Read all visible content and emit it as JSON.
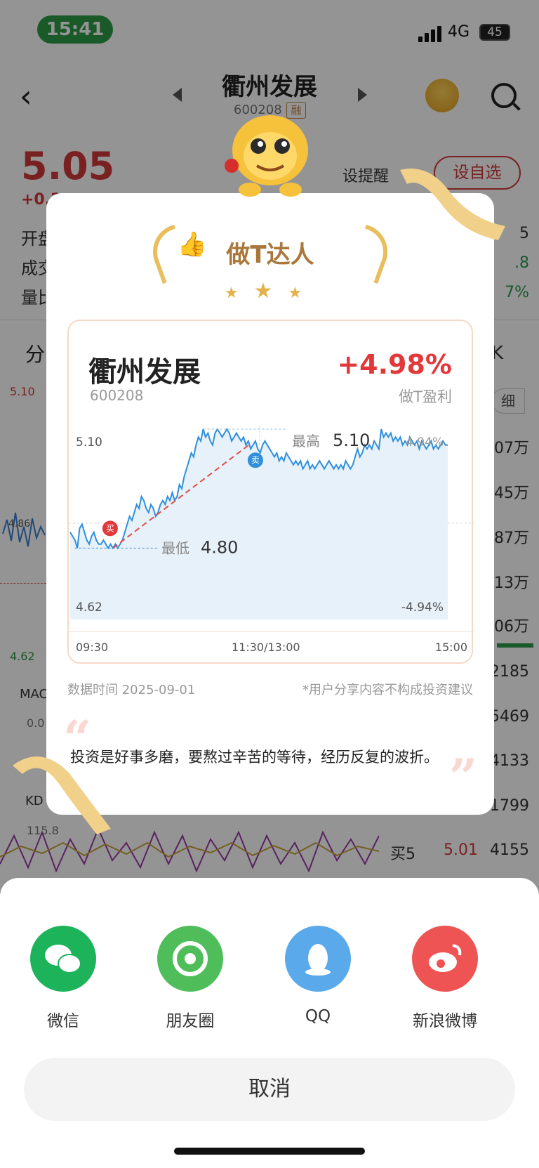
{
  "status_bar": {
    "time": "15:41",
    "network": "4G",
    "battery": "45"
  },
  "header": {
    "title": "衢州发展",
    "code": "600208",
    "margin_tag": "融"
  },
  "quote": {
    "price": "5.05",
    "change": "+0.2",
    "left_labels": [
      "开盘",
      "成交",
      "量比"
    ],
    "remind_label": "设提醒",
    "favorite_label": "设自选",
    "right_values": [
      "5",
      ".8",
      "7%"
    ]
  },
  "bg_tabs": {
    "tab_fen": "分",
    "tab_k": "K",
    "detail": "细"
  },
  "bg_chart": {
    "high": "5.10",
    "low": "4.62",
    "mid": "4.86",
    "macd": "MAC",
    "macd_val": "0.0",
    "kdj": "KD",
    "kdj_val": "115.8"
  },
  "bg_volumes": [
    "4.07万",
    "1.45万",
    "1.87万",
    "1.13万",
    "1.06万",
    "2185",
    "5469",
    "4133",
    "1799"
  ],
  "bg_buy5": {
    "label": "买5",
    "price": "5.01",
    "volume": "4155"
  },
  "card": {
    "badge_title": "做T达人",
    "stock_name": "衢州发展",
    "stock_code": "600208",
    "profit_pct": "+4.98%",
    "profit_label": "做T盈利",
    "data_date": "数据时间 2025-09-01",
    "disclaimer": "*用户分享内容不构成投资建议",
    "quote_text": "投资是好事多磨，要熬过辛苦的等待，经历反复的波折。"
  },
  "chart_data": {
    "type": "line",
    "title": "",
    "y_axis_left": {
      "top": "5.10",
      "bottom": "4.62"
    },
    "y_axis_right": {
      "top": "4.94%",
      "bottom": "-4.94%"
    },
    "ylim": [
      4.62,
      5.1
    ],
    "x_ticks": [
      "09:30",
      "11:30/13:00",
      "15:00"
    ],
    "high_label": "最高",
    "high_value": "5.10",
    "low_label": "最低",
    "low_value": "4.80",
    "buy_marker": {
      "label": "买",
      "time_index": 18,
      "price": 4.8
    },
    "sell_marker": {
      "label": "卖",
      "time_index": 78,
      "price": 5.05
    },
    "grid": true,
    "series": [
      {
        "values": [
          4.84,
          4.83,
          4.82,
          4.8,
          4.85,
          4.86,
          4.84,
          4.82,
          4.81,
          4.83,
          4.84,
          4.82,
          4.81,
          4.81,
          4.82,
          4.81,
          4.8,
          4.81,
          4.8,
          4.81,
          4.8,
          4.81,
          4.82,
          4.84,
          4.86,
          4.88,
          4.87,
          4.89,
          4.91,
          4.9,
          4.93,
          4.92,
          4.9,
          4.89,
          4.91,
          4.9,
          4.88,
          4.89,
          4.91,
          4.92,
          4.91,
          4.93,
          4.92,
          4.94,
          4.92,
          4.93,
          4.96,
          4.95,
          4.98,
          5.0,
          5.02,
          5.04,
          5.03,
          5.06,
          5.08,
          5.07,
          5.1,
          5.08,
          5.09,
          5.07,
          5.06,
          5.09,
          5.1,
          5.09,
          5.08,
          5.09,
          5.1,
          5.09,
          5.07,
          5.08,
          5.09,
          5.08,
          5.07,
          5.08,
          5.06,
          5.07,
          5.05,
          5.06,
          5.07,
          5.05,
          5.04,
          5.06,
          5.07,
          5.06,
          5.05,
          5.04,
          5.03,
          5.04,
          5.02,
          5.03,
          5.02,
          5.04,
          5.03,
          5.02,
          5.01,
          5.02,
          5.01,
          5.02,
          5.0,
          5.01,
          5.02,
          5.0,
          5.01,
          5.0,
          5.01,
          5.02,
          5.01,
          5.0,
          5.01,
          5.02,
          5.01,
          5.0,
          5.01,
          5.0,
          5.01,
          5.0,
          5.02,
          5.01,
          5.0,
          5.01,
          5.03,
          5.05,
          5.03,
          5.04,
          5.06,
          5.05,
          5.06,
          5.05,
          5.07,
          5.06,
          5.05,
          5.1,
          5.08,
          5.09,
          5.08,
          5.09,
          5.07,
          5.08,
          5.07,
          5.08,
          5.06,
          5.07,
          5.06,
          5.08,
          5.07,
          5.06,
          5.07,
          5.05,
          5.07,
          5.06,
          5.05,
          5.06,
          5.07,
          5.05,
          5.06,
          5.05,
          5.06,
          5.07,
          5.06,
          5.06
        ]
      }
    ]
  },
  "share": {
    "items": [
      {
        "label": "微信",
        "color": "#1db35a"
      },
      {
        "label": "朋友圈",
        "color": "#4fbe5a"
      },
      {
        "label": "QQ",
        "color": "#5aa9ea"
      },
      {
        "label": "新浪微博",
        "color": "#ee5454"
      }
    ],
    "cancel": "取消"
  }
}
